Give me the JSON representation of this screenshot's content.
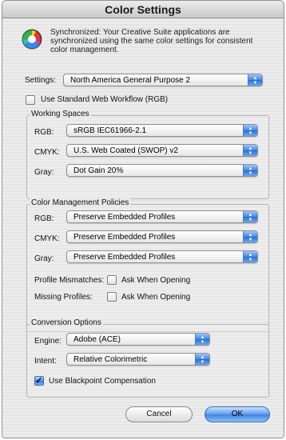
{
  "window": {
    "title": "Color Settings"
  },
  "sync": {
    "icon": "color-wheel-icon",
    "line1": "Synchronized: Your Creative Suite applications are",
    "line2": "synchronized using the same color settings for consistent",
    "line3": "color management."
  },
  "settings": {
    "label": "Settings:",
    "value": "North America General Purpose 2"
  },
  "web_workflow": {
    "label": "Use Standard Web Workflow (RGB)",
    "checked": false
  },
  "working_spaces": {
    "title": "Working Spaces",
    "rgb_label": "RGB:",
    "rgb_value": "sRGB IEC61966-2.1",
    "cmyk_label": "CMYK:",
    "cmyk_value": "U.S. Web Coated (SWOP) v2",
    "gray_label": "Gray:",
    "gray_value": "Dot Gain 20%"
  },
  "policies": {
    "title": "Color Management Policies",
    "rgb_label": "RGB:",
    "rgb_value": "Preserve Embedded Profiles",
    "cmyk_label": "CMYK:",
    "cmyk_value": "Preserve Embedded Profiles",
    "gray_label": "Gray:",
    "gray_value": "Preserve Embedded Profiles",
    "mismatch_label": "Profile Mismatches:",
    "mismatch_ask": "Ask When Opening",
    "missing_label": "Missing Profiles:",
    "missing_ask": "Ask When Opening"
  },
  "conversion": {
    "title": "Conversion Options",
    "engine_label": "Engine:",
    "engine_value": "Adobe (ACE)",
    "intent_label": "Intent:",
    "intent_value": "Relative Colorimetric",
    "blackpoint_label": "Use Blackpoint Compensation",
    "blackpoint_checked": true
  },
  "buttons": {
    "cancel": "Cancel",
    "ok": "OK"
  },
  "colors": {
    "accent": "#3d82e2",
    "window_bg": "#e9e9e9"
  }
}
